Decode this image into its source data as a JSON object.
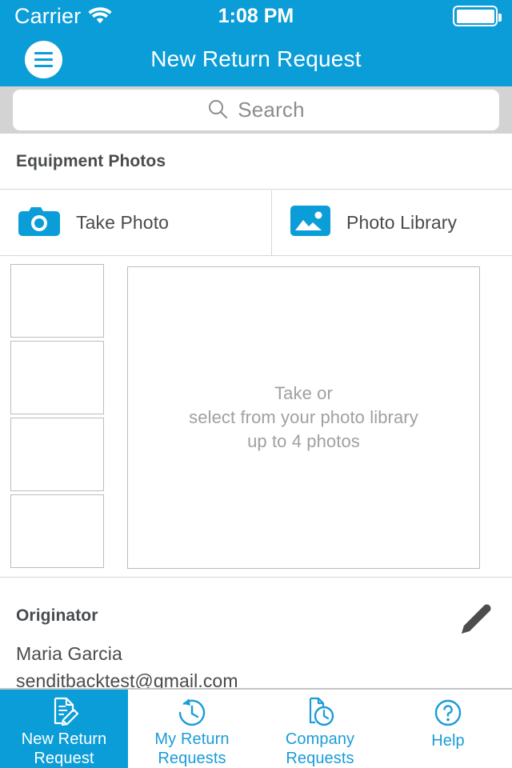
{
  "status_bar": {
    "carrier": "Carrier",
    "wifi_icon": "wifi-icon",
    "time": "1:08 PM",
    "battery_icon": "battery-full-icon"
  },
  "nav_bar": {
    "menu_icon": "hamburger-menu-icon",
    "title": "New Return Request"
  },
  "search": {
    "icon": "search-icon",
    "placeholder": "Search",
    "value": ""
  },
  "sections": {
    "equipment_photos": {
      "header": "Equipment Photos",
      "actions": [
        {
          "id": "take-photo",
          "label": "Take Photo",
          "icon": "camera-icon"
        },
        {
          "id": "photo-library",
          "label": "Photo Library",
          "icon": "photo-library-icon"
        }
      ],
      "thumbnail_count": 4,
      "thumbnails": [
        "",
        "",
        "",
        ""
      ],
      "preview_placeholder": {
        "line1": "Take or",
        "line2": "select from your photo library",
        "line3": "up to 4 photos"
      }
    },
    "originator": {
      "header": "Originator",
      "edit_icon": "edit-pencil-icon",
      "name": "Maria Garcia",
      "email": "senditbacktest@gmail.com",
      "phone": ""
    }
  },
  "tab_bar": {
    "active_index": 0,
    "tabs": [
      {
        "id": "new-return-request",
        "icon": "document-edit-icon",
        "line1": "New Return",
        "line2": "Request"
      },
      {
        "id": "my-return-requests",
        "icon": "clock-back-icon",
        "line1": "My Return",
        "line2": "Requests"
      },
      {
        "id": "company-requests",
        "icon": "document-clock-icon",
        "line1": "Company",
        "line2": "Requests"
      },
      {
        "id": "help",
        "icon": "question-circle-icon",
        "line1": "Help",
        "line2": ""
      }
    ]
  },
  "colors": {
    "brand_blue": "#0b9dd7",
    "tab_blue": "#1a9cd8",
    "search_bg": "#d3d3d3",
    "divider": "#d6d6d6",
    "text_dark": "#4a4a4a",
    "text_muted": "#a0a0a0"
  }
}
